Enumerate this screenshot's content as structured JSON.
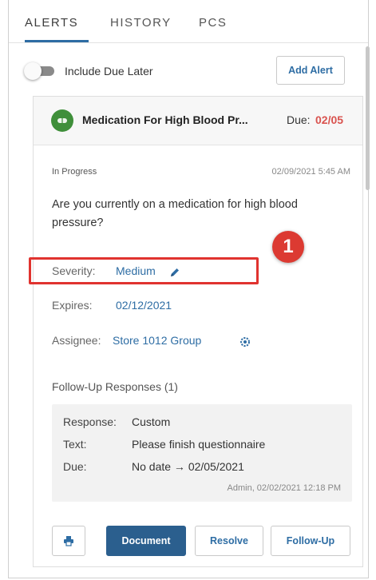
{
  "tabs": [
    {
      "label": "ALERTS",
      "active": true
    },
    {
      "label": "HISTORY",
      "active": false
    },
    {
      "label": "PCS",
      "active": false
    }
  ],
  "toggle": {
    "label": "Include Due Later",
    "on": false
  },
  "add_alert_label": "Add Alert",
  "alert": {
    "title": "Medication For High Blood Pr...",
    "due_label": "Due:",
    "due_value": "02/05",
    "status": "In Progress",
    "timestamp": "02/09/2021 5:45 AM",
    "question": "Are you currently on a medication for high blood pressure?",
    "severity_label": "Severity:",
    "severity_value": "Medium",
    "expires_label": "Expires:",
    "expires_value": "02/12/2021",
    "assignee_label": "Assignee:",
    "assignee_value": "Store 1012 Group",
    "followup_title": "Follow-Up Responses (1)",
    "response": {
      "response_label": "Response:",
      "response_value": "Custom",
      "text_label": "Text:",
      "text_value": "Please finish questionnaire",
      "due_label": "Due:",
      "due_value": "No date → 02/05/2021",
      "meta": "Admin, 02/02/2021 12:18 PM"
    }
  },
  "actions": {
    "document": "Document",
    "resolve": "Resolve",
    "follow_up": "Follow-Up"
  },
  "callout_number": "1",
  "colors": {
    "accent": "#2e6da4",
    "primary_button": "#2b5f8e",
    "due_red": "#d9534f",
    "highlight_red": "#e0332f",
    "med_icon_green": "#3f8f3a"
  }
}
